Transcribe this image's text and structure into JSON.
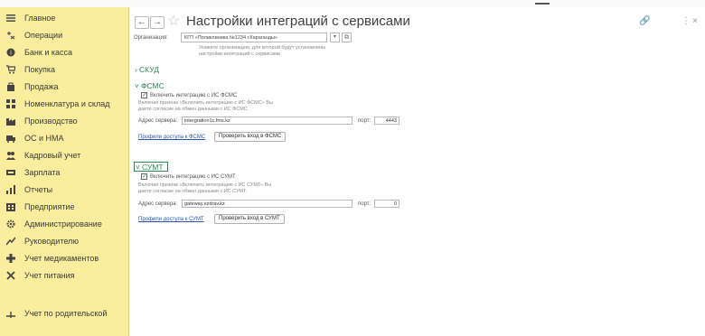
{
  "sidebar": {
    "items": [
      {
        "label": "Главное",
        "icon": "menu-icon"
      },
      {
        "label": "Операции",
        "icon": "operations-icon"
      },
      {
        "label": "Банк и касса",
        "icon": "bank-icon"
      },
      {
        "label": "Покупка",
        "icon": "cart-icon"
      },
      {
        "label": "Продажа",
        "icon": "sales-icon"
      },
      {
        "label": "Номенклатура и склад",
        "icon": "warehouse-icon"
      },
      {
        "label": "Производство",
        "icon": "factory-icon"
      },
      {
        "label": "ОС и НМА",
        "icon": "assets-icon"
      },
      {
        "label": "Кадровый учет",
        "icon": "people-icon"
      },
      {
        "label": "Зарплата",
        "icon": "salary-icon"
      },
      {
        "label": "Отчеты",
        "icon": "reports-icon"
      },
      {
        "label": "Предприятие",
        "icon": "enterprise-icon"
      },
      {
        "label": "Администрирование",
        "icon": "gear-icon"
      },
      {
        "label": "Руководителю",
        "icon": "trend-icon"
      },
      {
        "label": "Учет медикаментов",
        "icon": "medical-cross-icon"
      },
      {
        "label": "Учет питания",
        "icon": "cutlery-icon"
      },
      {
        "label": "Учет по родительской",
        "icon": "parent-icon"
      }
    ]
  },
  "header": {
    "back": "←",
    "forward": "→",
    "star": "☆",
    "title": "Настройки интеграций с сервисами",
    "link_icon": "🔗",
    "more_icon": "⋮",
    "close_icon": "×"
  },
  "org": {
    "label": "Организация:",
    "value": "КГП «Поликлиника №1234 г.Караганды»",
    "dropdown": "▾",
    "open": "⧉",
    "hint_line1": "Укажите организацию, для которой будут установлены",
    "hint_line2": "настройки интеграций с сервисами"
  },
  "skud": {
    "chevron": "›",
    "title": "СКУД"
  },
  "fmss": {
    "chevron": "˅",
    "title": "ФСМС",
    "checkbox_label": "Включить интеграцию с ИС ФСМС",
    "checked_mark": "✓",
    "note_line1": "Включая признак «Включить интеграцию с ИС ФСМС» Вы",
    "note_line2": "даете согласие на обмен данными с ИС ФСМС",
    "server_label": "Адрес сервера:",
    "server_value": "intergration1c.fms.kz",
    "port_label": "порт:",
    "port_value": "4443",
    "profiles_link": "Профили доступа к ФСМС",
    "check_button": "Проверить вход в ФСМС"
  },
  "sumt": {
    "chevron": "˅",
    "title": "СУМТ",
    "checkbox_label": "Включить интеграцию с ИС СУМТ",
    "checked_mark": "✓",
    "note_line1": "Включая признак «Включить интеграцию с ИС СУМТ» Вы",
    "note_line2": "даете согласие на обмен данными с ИС СУМТ.",
    "server_label": "Адрес сервера:",
    "server_value": "gateway.ezdrav.kz",
    "port_label": "порт:",
    "port_value": "0",
    "profiles_link": "Профили доступа к СУМТ",
    "check_button": "Проверить вход в СУМТ"
  },
  "colors": {
    "sidebar_bg": "#fbed9e",
    "accent_green": "#2e8b57",
    "link_blue": "#2a55b0"
  }
}
